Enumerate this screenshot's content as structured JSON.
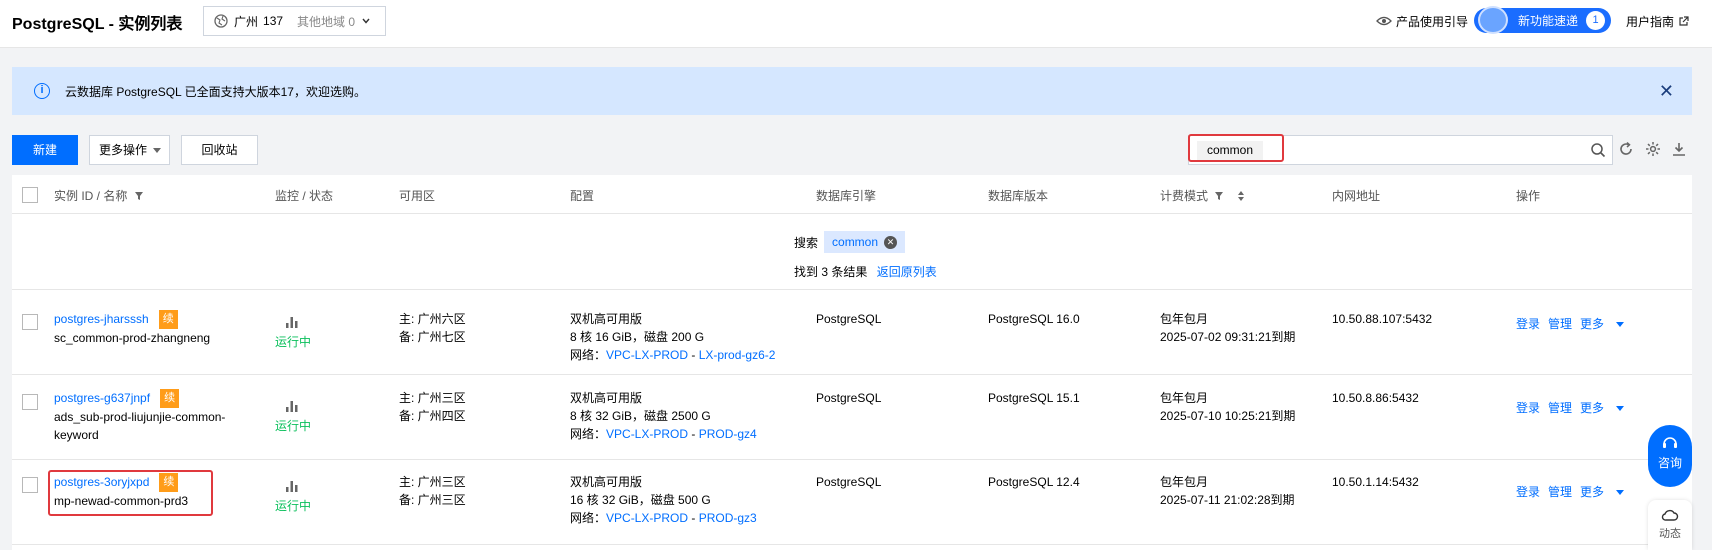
{
  "header": {
    "title": "PostgreSQL - 实例列表",
    "region": {
      "name": "广州",
      "count": "137",
      "other": "其他地域 0"
    },
    "product_guide": "产品使用引导",
    "new_feature": {
      "label": "新功能速递",
      "count": "1"
    },
    "user_guide": "用户指南"
  },
  "notice": {
    "text": "云数据库 PostgreSQL 已全面支持大版本17，欢迎选购。"
  },
  "toolbar": {
    "new_label": "新建",
    "more_label": "更多操作",
    "recycle_label": "回收站",
    "search_tag": "common"
  },
  "table": {
    "headers": {
      "id_name": "实例 ID / 名称",
      "monitor": "监控 / 状态",
      "zone": "可用区",
      "config": "配置",
      "engine": "数据库引擎",
      "version": "数据库版本",
      "billing": "计费模式",
      "ip": "内网地址",
      "ops": "操作"
    },
    "summary": {
      "search_label": "搜索",
      "keyword": "common",
      "found": "找到 3 条结果",
      "back": "返回原列表"
    },
    "rows": [
      {
        "id": "postgres-jharsssh",
        "name": "sc_common-prod-zhangneng",
        "renew": "续",
        "status": "运行中",
        "zone_main": "主: 广州六区",
        "zone_backup": "备: 广州七区",
        "config_type": "双机高可用版",
        "config_spec": "8 核 16 GiB，磁盘 200 G",
        "net_label": "网络：",
        "vpc": "VPC-LX-PROD",
        "subnet": "LX-prod-gz6-2",
        "engine": "PostgreSQL",
        "version": "PostgreSQL 16.0",
        "billing": "包年包月",
        "expire": "2025-07-02 09:31:21到期",
        "ip": "10.50.88.107:5432",
        "op_login": "登录",
        "op_manage": "管理",
        "op_more": "更多"
      },
      {
        "id": "postgres-g637jnpf",
        "name": "ads_sub-prod-liujunjie-common-keyword",
        "renew": "续",
        "status": "运行中",
        "zone_main": "主: 广州三区",
        "zone_backup": "备: 广州四区",
        "config_type": "双机高可用版",
        "config_spec": "8 核 32 GiB，磁盘 2500 G",
        "net_label": "网络：",
        "vpc": "VPC-LX-PROD",
        "subnet": "PROD-gz4",
        "engine": "PostgreSQL",
        "version": "PostgreSQL 15.1",
        "billing": "包年包月",
        "expire": "2025-07-10 10:25:21到期",
        "ip": "10.50.8.86:5432",
        "op_login": "登录",
        "op_manage": "管理",
        "op_more": "更多"
      },
      {
        "id": "postgres-3oryjxpd",
        "name": "mp-newad-common-prd3",
        "renew": "续",
        "status": "运行中",
        "zone_main": "主: 广州三区",
        "zone_backup": "备: 广州三区",
        "config_type": "双机高可用版",
        "config_spec": "16 核 32 GiB，磁盘 500 G",
        "net_label": "网络：",
        "vpc": "VPC-LX-PROD",
        "subnet": "PROD-gz3",
        "engine": "PostgreSQL",
        "version": "PostgreSQL 12.4",
        "billing": "包年包月",
        "expire": "2025-07-11 21:02:28到期",
        "ip": "10.50.1.14:5432",
        "op_login": "登录",
        "op_manage": "管理",
        "op_more": "更多"
      }
    ]
  },
  "floating": {
    "consult": "咨询",
    "dynamic": "动态"
  },
  "colors": {
    "primary": "#006eff",
    "running": "#0abf5b",
    "renew": "#ff9c19",
    "highlight": "#e0393e",
    "notice_bg": "#d5e7ff"
  }
}
